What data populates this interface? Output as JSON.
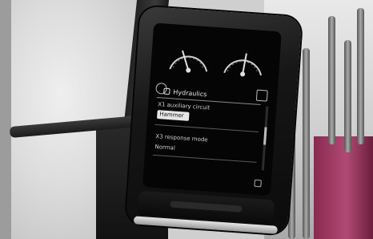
{
  "screen": {
    "menu_title": "Hydraulics",
    "items": [
      {
        "label": "X1 auxiliary circuit",
        "value": "Hammer"
      },
      {
        "label": "X3 response mode",
        "value": "Normal"
      }
    ],
    "scroll_position": 0.45
  },
  "icons": {
    "gauge_left": "analog-gauge",
    "gauge_right": "analog-gauge",
    "mode": "mode-icon",
    "alt": "alt-icon",
    "hydraulics": "hydraulics-icon",
    "corner": "settings-icon"
  },
  "colors": {
    "screen_bg": "#050505",
    "screen_text": "#d8d8d8",
    "highlight_bg": "#e6e6e6",
    "magenta_hose": "#b04a74"
  }
}
